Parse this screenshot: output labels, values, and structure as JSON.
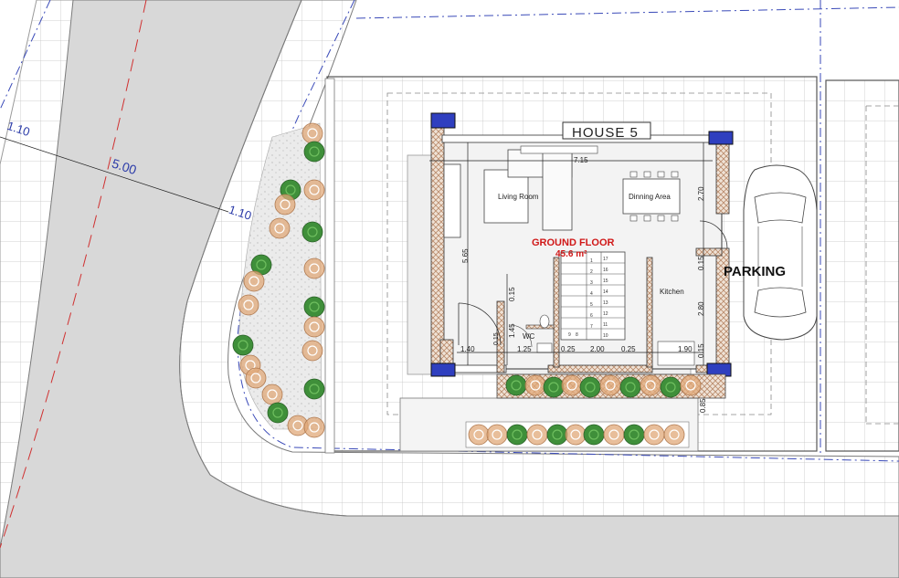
{
  "plan": {
    "house_label": "HOUSE 5",
    "floor_title": "GROUND FLOOR",
    "floor_area": "45.6 m²",
    "parking_label": "PARKING",
    "rooms": {
      "living": "Living Room",
      "dining": "Dinning Area",
      "kitchen": "Kitchen",
      "wc": "WC"
    },
    "street_dims": {
      "setback_upper": "1.10",
      "road_width": "5.00",
      "setback_lower": "1.10"
    },
    "dims": {
      "top_width": "7.15",
      "left_height": "5.65",
      "right_upper": "2.70",
      "right_mid": "0.15",
      "right_lower": "2.80",
      "right_bottom": "0.15",
      "wc_top": "0.15",
      "wc_height": "1.45",
      "wc_small": "0.15",
      "bottom_1": "1.40",
      "bottom_2": "1.25",
      "bottom_3": "0.25",
      "bottom_4": "2.00",
      "bottom_5": "0.25",
      "bottom_6": "1.90",
      "side_bottom": "0.85"
    },
    "stairs": [
      "17",
      "16",
      "15",
      "14",
      "13",
      "12",
      "11",
      "10",
      "1",
      "2",
      "3",
      "4",
      "5",
      "6",
      "7",
      "8",
      "9"
    ]
  },
  "colors": {
    "wall_hatch": "#c8a890",
    "column": "#2f3fbf",
    "tree_green": "#3f8f3a",
    "shrub_orange": "#e0a878",
    "title_red": "#d01818",
    "dim_blue": "#2a3aa8",
    "road_grey": "#d6d6d6"
  }
}
